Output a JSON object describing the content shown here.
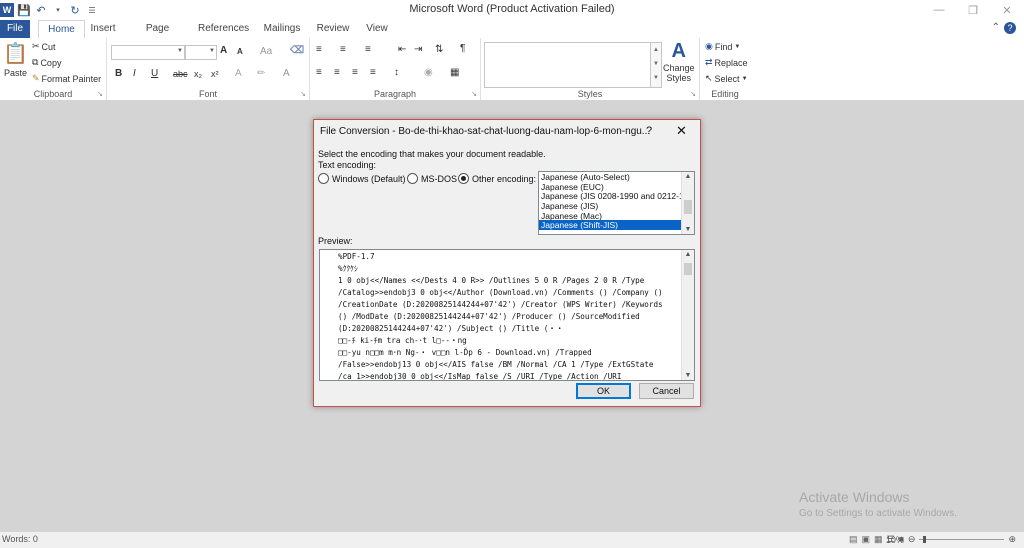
{
  "app": {
    "title": "Microsoft Word (Product Activation Failed)",
    "qat": [
      "save-icon",
      "undo-icon",
      "redo-icon",
      "customize-icon"
    ]
  },
  "tabs": [
    "File",
    "Home",
    "Insert",
    "Page Layout",
    "References",
    "Mailings",
    "Review",
    "View"
  ],
  "ribbon": {
    "clipboard": {
      "label": "Clipboard",
      "paste": "Paste",
      "cut": "Cut",
      "copy": "Copy",
      "format_painter": "Format Painter"
    },
    "font": {
      "label": "Font",
      "bold": "B",
      "italic": "I",
      "underline": "U",
      "strike": "abc",
      "sub": "x₂",
      "sup": "x²",
      "grow": "A",
      "shrink": "A",
      "case": "Aa",
      "color": "A"
    },
    "paragraph": {
      "label": "Paragraph",
      "pilcrow": "¶"
    },
    "styles": {
      "label": "Styles",
      "change_styles": "Change",
      "change_styles2": "Styles"
    },
    "editing": {
      "label": "Editing",
      "find": "Find",
      "replace": "Replace",
      "select": "Select"
    }
  },
  "dialog": {
    "title": "File Conversion - Bo-de-thi-khao-sat-chat-luong-dau-nam-lop-6-mon-ngu...",
    "help": "?",
    "close": "✕",
    "instruction": "Select the encoding that makes your document readable.",
    "text_encoding_label": "Text encoding:",
    "options": {
      "windows": "Windows (Default)",
      "msdos": "MS-DOS",
      "other": "Other encoding:"
    },
    "selected_option": "other",
    "encodings": [
      "Japanese (Auto-Select)",
      "Japanese (EUC)",
      "Japanese (JIS 0208-1990 and 0212-19",
      "Japanese (JIS)",
      "Japanese (Mac)",
      "Japanese (Shift-JIS)"
    ],
    "selected_encoding": "Japanese (Shift-JIS)",
    "preview_label": "Preview:",
    "preview_lines": [
      "%PDF-1.7",
      "%ｸｸｹｼ",
      "1 0 obj<</Names <</Dests 4 0 R>> /Outlines 5 0 R /Pages 2 0 R /Type",
      "/Catalog>>endobj3 0 obj<</Author (Download.vn) /Comments () /Company ()",
      "/CreationDate (D:20200825144244+07'42') /Creator (WPS Writer) /Keywords",
      "() /ModDate (D:20200825144244+07'42') /Producer () /SourceModified",
      "(D:20200825144244+07'42') /Subject () /Title (・・",
      "□□-ﾁ ki-ﾁm tra ch-･t l□--・ng",
      "□□-yu n□□m m･n Ng-・ v□□n l-Ďp 6 - Download.vn) /Trapped",
      "/False>>endobj13 0 obj<</AIS false /BM /Normal /CA 1 /Type /ExtGState",
      "/ca 1>>endobj30 0 obj<</IsMap false /S /URI /Type /Action /URI"
    ],
    "ok": "OK",
    "cancel": "Cancel"
  },
  "watermark": {
    "line1": "Activate Windows",
    "line2": "Go to Settings to activate Windows."
  },
  "status": {
    "words": "Words: 0",
    "zoom": "10%"
  }
}
